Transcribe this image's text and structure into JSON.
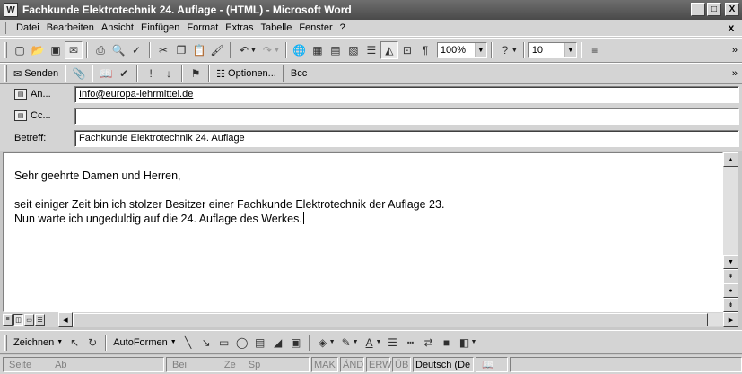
{
  "window": {
    "title": "Fachkunde Elektrotechnik 24. Auflage - (HTML) - Microsoft Word",
    "app_icon": "W",
    "controls": [
      "_",
      "□",
      "X"
    ]
  },
  "menu": {
    "items": [
      "Datei",
      "Bearbeiten",
      "Ansicht",
      "Einfügen",
      "Format",
      "Extras",
      "Tabelle",
      "Fenster",
      "?"
    ],
    "doc_close": "x"
  },
  "toolbar": {
    "zoom": "100%",
    "font_size": "10"
  },
  "email_toolbar": {
    "send_label": "Senden",
    "options_label": "Optionen...",
    "bcc_label": "Bcc"
  },
  "email": {
    "to_label": "An...",
    "to_value": "Info@europa-lehrmittel.de",
    "cc_label": "Cc...",
    "cc_value": "",
    "subject_label": "Betreff:",
    "subject_value": "Fachkunde Elektrotechnik 24. Auflage"
  },
  "document": {
    "greeting": "Sehr geehrte Damen und Herren,",
    "line1": "seit einiger Zeit bin ich stolzer Besitzer einer Fachkunde Elektrotechnik der Auflage 23.",
    "line2": "Nun warte ich ungeduldig auf die 24. Auflage des Werkes."
  },
  "drawing_toolbar": {
    "draw_label": "Zeichnen",
    "autoshapes_label": "AutoFormen"
  },
  "statusbar": {
    "page": "Seite",
    "section": "Ab",
    "at": "Bei",
    "line": "Ze",
    "column": "Sp",
    "mak": "MAK",
    "and": "ÄND",
    "erw": "ERW",
    "ub": "ÜB",
    "language": "Deutsch (De"
  }
}
